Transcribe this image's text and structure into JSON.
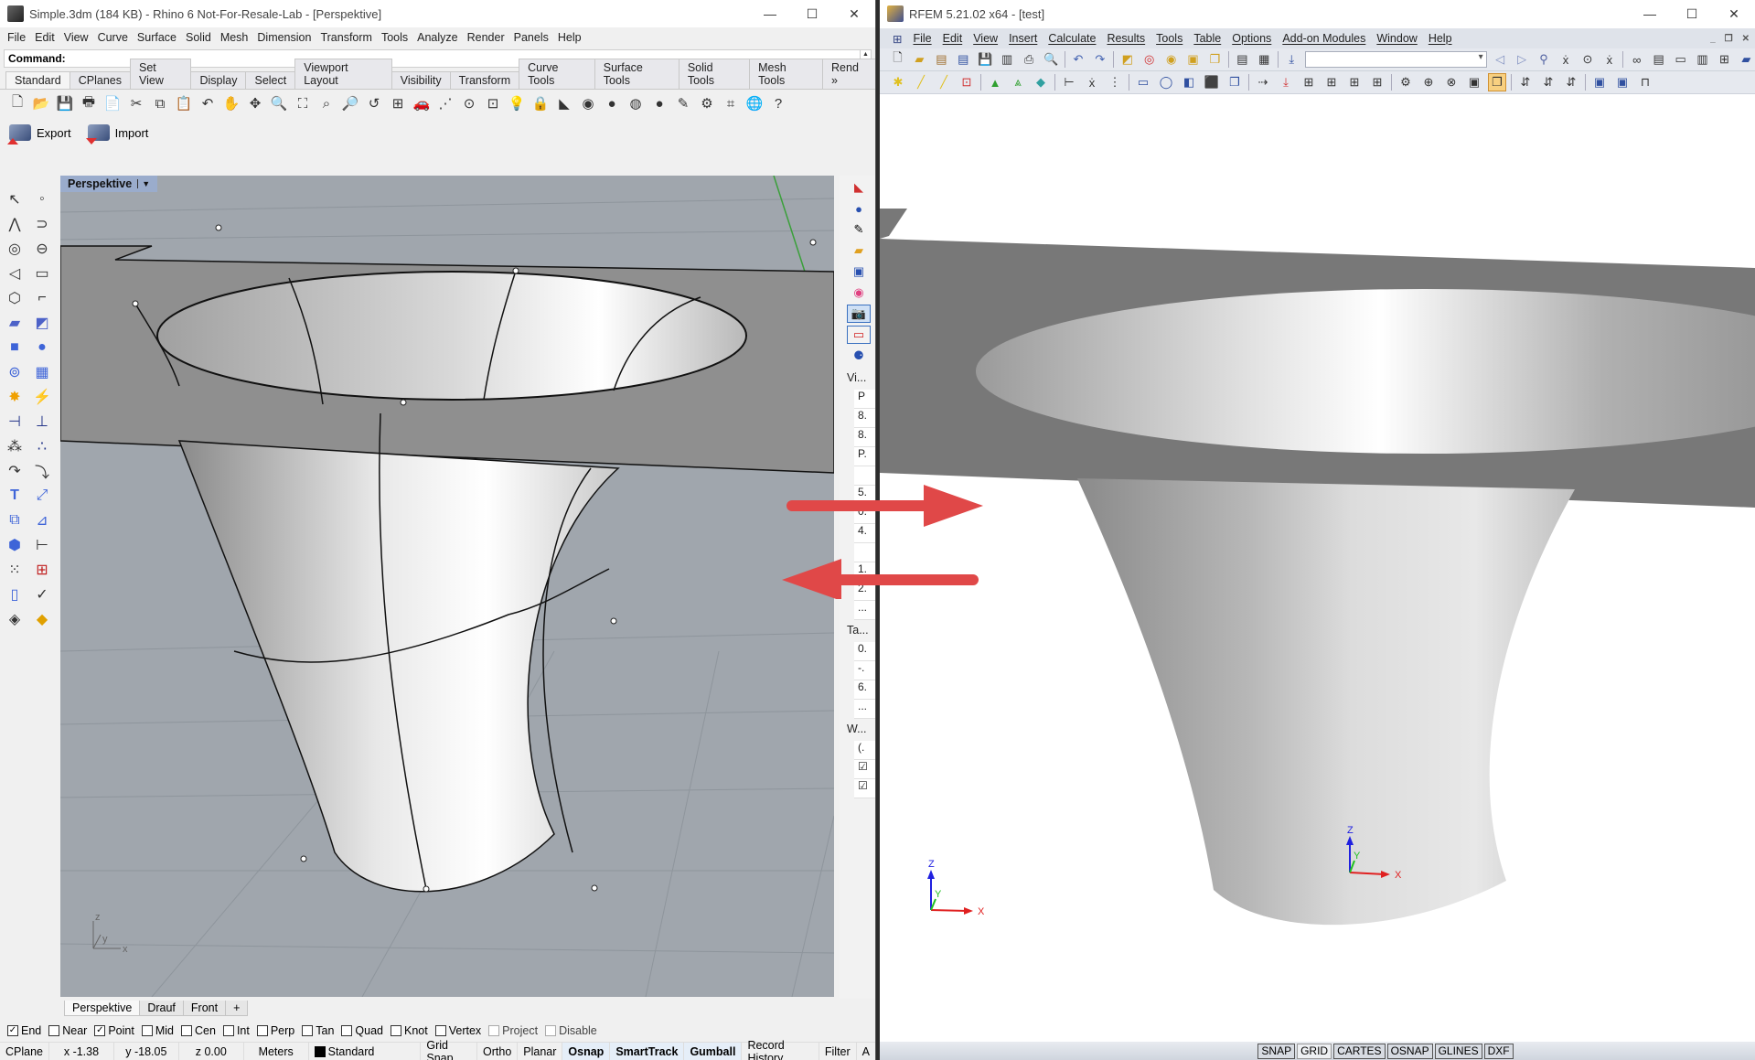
{
  "rhino": {
    "title": "Simple.3dm (184 KB) - Rhino 6 Not-For-Resale-Lab - [Perspektive]",
    "window_controls": [
      "minimize",
      "maximize",
      "close"
    ],
    "menu": [
      "File",
      "Edit",
      "View",
      "Curve",
      "Surface",
      "Solid",
      "Mesh",
      "Dimension",
      "Transform",
      "Tools",
      "Analyze",
      "Render",
      "Panels",
      "Help"
    ],
    "command_label": "Command:",
    "toolbar_tabs": [
      "Standard",
      "CPlanes",
      "Set View",
      "Display",
      "Select",
      "Viewport Layout",
      "Visibility",
      "Transform",
      "Curve Tools",
      "Surface Tools",
      "Solid Tools",
      "Mesh Tools",
      "Rend »"
    ],
    "active_toolbar_tab": "Standard",
    "standard_tools": [
      "new-file",
      "open-folder",
      "save",
      "print",
      "import-file",
      "cut",
      "copy",
      "paste",
      "undo",
      "pan",
      "rotate-view",
      "zoom-window",
      "zoom-extents",
      "zoom-dynamic",
      "zoom-selected",
      "undo-view",
      "four-viewports",
      "car-render",
      "grid-snap",
      "circle-snap",
      "osnap-point",
      "light-bulb",
      "lock",
      "material",
      "color-wheel",
      "sphere-shaded",
      "sphere-render",
      "blue-sphere",
      "pencil",
      "gear",
      "select-points",
      "globe",
      "help"
    ],
    "export_label": "Export",
    "import_label": "Import",
    "viewport_title": "Perspektive",
    "viewport_tabs": [
      "Perspektive",
      "Drauf",
      "Front",
      "+"
    ],
    "active_viewport_tab": "Perspektive",
    "side_panel": {
      "section_view": "Vi...",
      "view_cells": [
        "P",
        "8.",
        "8.",
        "P.",
        "",
        "5.",
        "0.",
        "4.",
        "",
        "1.",
        "2.",
        "..."
      ],
      "section_target": "Ta...",
      "target_cells": [
        "0.",
        "-.",
        "6.",
        "..."
      ],
      "section_wallpaper": "W...",
      "wallpaper_cells": [
        "(.",
        "☑",
        "☑"
      ]
    },
    "osnaps": [
      {
        "label": "End",
        "checked": true
      },
      {
        "label": "Near",
        "checked": false
      },
      {
        "label": "Point",
        "checked": true
      },
      {
        "label": "Mid",
        "checked": false
      },
      {
        "label": "Cen",
        "checked": false
      },
      {
        "label": "Int",
        "checked": false
      },
      {
        "label": "Perp",
        "checked": false
      },
      {
        "label": "Tan",
        "checked": false
      },
      {
        "label": "Quad",
        "checked": false
      },
      {
        "label": "Knot",
        "checked": false
      },
      {
        "label": "Vertex",
        "checked": false
      },
      {
        "label": "Project",
        "checked": false,
        "disabled": true
      },
      {
        "label": "Disable",
        "checked": false,
        "disabled": true
      }
    ],
    "status": {
      "cplane": "CPlane",
      "x": "x -1.38",
      "y": "y -18.05",
      "z": "z 0.00",
      "units": "Meters",
      "layer": "Standard",
      "grid_snap": "Grid Snap",
      "ortho": "Ortho",
      "planar": "Planar",
      "osnap": "Osnap",
      "smarttrack": "SmartTrack",
      "gumball": "Gumball",
      "record_history": "Record History",
      "filter": "Filter",
      "more": "A"
    },
    "axis_labels": {
      "x": "x",
      "y": "y",
      "z": "z"
    }
  },
  "rfem": {
    "title": "RFEM 5.21.02 x64 - [test]",
    "window_controls": [
      "minimize",
      "maximize",
      "close"
    ],
    "menu": [
      "File",
      "Edit",
      "View",
      "Insert",
      "Calculate",
      "Results",
      "Tools",
      "Table",
      "Options",
      "Add-on Modules",
      "Window",
      "Help"
    ],
    "mdi_controls": [
      "_",
      "❐",
      "✕"
    ],
    "status_buttons": [
      {
        "label": "SNAP",
        "on": false
      },
      {
        "label": "GRID",
        "on": true
      },
      {
        "label": "CARTES",
        "on": false
      },
      {
        "label": "OSNAP",
        "on": false
      },
      {
        "label": "GLINES",
        "on": false
      },
      {
        "label": "DXF",
        "on": false
      }
    ],
    "axis_labels": {
      "x": "X",
      "y": "Y",
      "z": "Z"
    }
  },
  "colors": {
    "arrow": "#e04848",
    "rhino_viewport_bg": "#a0a6ad",
    "rhino_vp_tab": "#9aaccc",
    "rfem_plate": "#787878",
    "axis_x": "#e02020",
    "axis_y": "#20c020",
    "axis_z": "#2020e0"
  }
}
